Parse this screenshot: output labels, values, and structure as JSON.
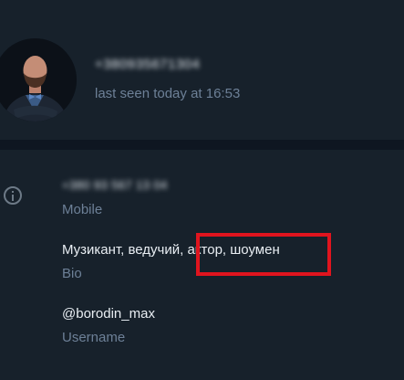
{
  "header": {
    "phone_number": "+380935671304",
    "status": "last seen today at 16:53"
  },
  "info": {
    "phone": {
      "value": "+380 93 567 13 04",
      "label": "Mobile"
    },
    "bio": {
      "value": "Музикант, ведучий, актор, шоумен",
      "label": "Bio"
    },
    "username": {
      "value": "@borodin_max",
      "label": "Username"
    }
  },
  "colors": {
    "background": "#17212b",
    "separator": "#0e1621",
    "text": "#e9eef3",
    "muted": "#6d8097",
    "highlight": "#e0141e"
  },
  "icons": {
    "info": "info-icon"
  }
}
